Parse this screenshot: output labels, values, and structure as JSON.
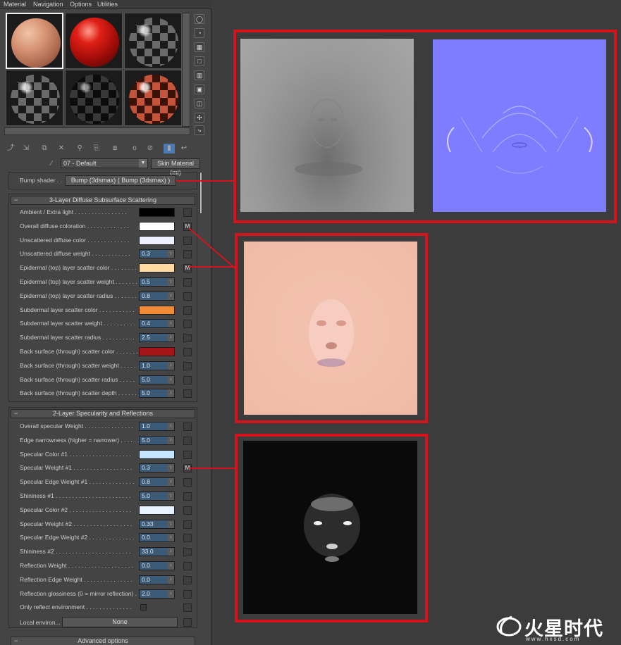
{
  "menu": [
    "Material",
    "Navigation",
    "Options",
    "Utilities"
  ],
  "material_name": "07 - Default",
  "material_type": "Skin Material (mi)",
  "bump": {
    "label": "Bump shader . .",
    "button": "Bump (3dsmax)  ( Bump (3dsmax) )"
  },
  "diffuse_rollout": {
    "title": "3-Layer Diffuse Subsurface Scattering",
    "collapse": "−",
    "rows": [
      {
        "label": "Ambient / Extra light . . . . . . . . . . . . . . . .",
        "kind": "color",
        "color": "#020202",
        "map": ""
      },
      {
        "label": "Overall diffuse coloration . . . . . . . . . . . . .",
        "kind": "color",
        "color": "#ffffff",
        "map": "M"
      },
      {
        "label": "Unscattered diffuse color . . . . . . . . . . . . .",
        "kind": "color",
        "color": "#eef0ff",
        "map": ""
      },
      {
        "label": "Unscattered diffuse weight . . . . . . . . . . . .",
        "kind": "value",
        "value": "0.3",
        "map": ""
      },
      {
        "label": "Epidermal (top) layer scatter color . . . . . . . .",
        "kind": "color",
        "color": "#ffd9a0",
        "map": "M"
      },
      {
        "label": "Epidermal (top) layer scatter weight . . . . . . .",
        "kind": "value",
        "value": "0.5",
        "map": ""
      },
      {
        "label": "Epidermal (top) layer scatter radius . . . . . . .",
        "kind": "value",
        "value": "0.8",
        "map": ""
      },
      {
        "label": "Subdermal layer scatter color . . . . . . . . . . .",
        "kind": "color",
        "color": "#f08a34",
        "map": ""
      },
      {
        "label": "Subdermal layer scatter weight . . . . . . . . . .",
        "kind": "value",
        "value": "0.4",
        "map": ""
      },
      {
        "label": "Subdermal layer scatter radius . . . . . . . . . .",
        "kind": "value",
        "value": "2.5",
        "map": ""
      },
      {
        "label": "Back surface (through) scatter color . . . . . . .",
        "kind": "color",
        "color": "#a51418",
        "map": ""
      },
      {
        "label": "Back surface (through) scatter weight . . . . .",
        "kind": "value",
        "value": "1.0",
        "map": ""
      },
      {
        "label": "Back surface (through) scatter radius . . . . .",
        "kind": "value",
        "value": "5.0",
        "map": ""
      },
      {
        "label": "Back surface (through) scatter depth . . . . . .",
        "kind": "value",
        "value": "5.0",
        "map": ""
      }
    ]
  },
  "specular_rollout": {
    "title": "2-Layer Specularity and Reflections",
    "collapse": "−",
    "rows": [
      {
        "label": "Overall specular Weight . . . . . . . . . . . . . . .",
        "kind": "value",
        "value": "1.0",
        "map": ""
      },
      {
        "label": "Edge narrowness (higher = narrower) . . . . . .",
        "kind": "value",
        "value": "5.0",
        "map": ""
      },
      {
        "label": "Specular Color #1 . . . . . . . . . . . . . . . . . . .",
        "kind": "color",
        "color": "#c4e4ff",
        "map": ""
      },
      {
        "label": "Specular Weight #1 . . . . . . . . . . . . . . . . . .",
        "kind": "value",
        "value": "0.3",
        "map": "M"
      },
      {
        "label": "Specular Edge Weight #1 . . . . . . . . . . . . . .",
        "kind": "value",
        "value": "0.8",
        "map": ""
      },
      {
        "label": "Shininess #1 . . . . . . . . . . . . . . . . . . . . . . .",
        "kind": "value",
        "value": "5.0",
        "map": ""
      },
      {
        "label": "Specular Color #2 . . . . . . . . . . . . . . . . . . .",
        "kind": "color",
        "color": "#e6f2ff",
        "map": ""
      },
      {
        "label": "Specular Weight #2 . . . . . . . . . . . . . . . . . .",
        "kind": "value",
        "value": "0.33",
        "map": ""
      },
      {
        "label": "Specular Edge Weight #2 . . . . . . . . . . . . . .",
        "kind": "value",
        "value": "0.0",
        "map": ""
      },
      {
        "label": "Shininess #2 . . . . . . . . . . . . . . . . . . . . . . .",
        "kind": "value",
        "value": "33.0",
        "map": ""
      },
      {
        "label": "Reflection Weight . . . . . . . . . . . . . . . . . . . .",
        "kind": "value",
        "value": "0.0",
        "map": ""
      },
      {
        "label": "Reflection Edge Weight . . . . . . . . . . . . . . .",
        "kind": "value",
        "value": "0.0",
        "map": ""
      },
      {
        "label": "Reflection glossiness (0 = mirror reflection) . .",
        "kind": "value",
        "value": "2.0",
        "map": ""
      },
      {
        "label": "Only reflect environment . . . . . . . . . . . . . .",
        "kind": "check",
        "map": ""
      }
    ]
  },
  "local_environment": {
    "label": "Local environ...",
    "button": "None"
  },
  "advanced_rollout": {
    "title": "Advanced options",
    "collapse": "−"
  },
  "side_tools": [
    "sphere-type-icon",
    "backlight-icon",
    "background-checker-icon",
    "sample-uv-icon",
    "video-color-check-icon",
    "make-preview-icon",
    "options-icon",
    "select-by-material-icon",
    "material-map-navigator-icon"
  ],
  "toolbar_icons": [
    "get-material-icon",
    "put-to-scene-icon",
    "assign-to-selection-icon",
    "reset-map-icon",
    "make-unique-icon",
    "put-to-library-icon",
    "material-id-channel-icon",
    "show-map-in-viewport-icon",
    "show-end-result-icon",
    "go-to-parent-icon",
    "go-forward-to-sibling-icon"
  ],
  "accent_colors": {
    "frame": "#d4141a",
    "normal_map": "#7f7dff"
  },
  "logo": {
    "name": "火星时代",
    "url": "www.hxsd.com"
  }
}
